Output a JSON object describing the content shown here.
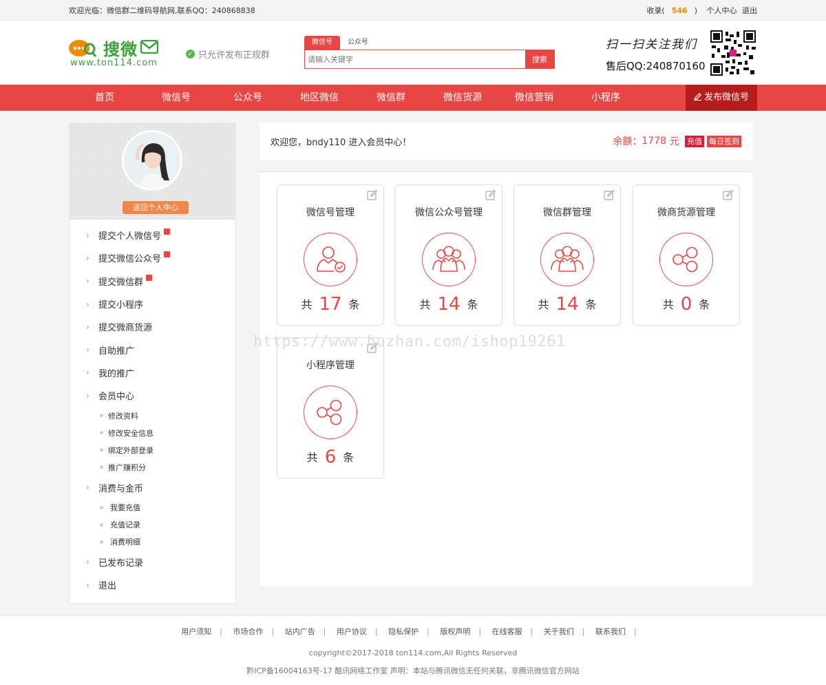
{
  "topbar": {
    "welcome": "欢迎光临：微信群二维码导航网,联系QQ：240868838",
    "fav_label": "收录(",
    "fav_count": "546",
    "fav_close": ")",
    "member_center": "个人中心",
    "logout": "退出"
  },
  "header": {
    "logo_text": "搜微",
    "logo_url": "www.ton114.com",
    "notice": "只允许发布正规群",
    "search": {
      "tabs": [
        "微信号",
        "公众号"
      ],
      "placeholder": "请输入关键字",
      "button": "搜索"
    },
    "slogan": "扫一扫关注我们",
    "aftersale": "售后QQ:240870160"
  },
  "nav": {
    "items": [
      "首页",
      "微信号",
      "公众号",
      "地区微信",
      "微信群",
      "微信货源",
      "微信营销",
      "小程序"
    ],
    "publish": "发布微信号"
  },
  "sidebar": {
    "back_button": "返回个人中心",
    "menu": [
      {
        "label": "提交个人微信号",
        "hot": true
      },
      {
        "label": "提交微信公众号",
        "hot": true
      },
      {
        "label": "提交微信群",
        "hot": true
      },
      {
        "label": "提交小程序",
        "hot": false
      },
      {
        "label": "提交微商货源",
        "hot": false
      },
      {
        "label": "自助推广",
        "hot": false
      },
      {
        "label": "我的推广",
        "hot": false
      },
      {
        "label": "会员中心",
        "hot": false
      },
      {
        "label": "消费与金币",
        "hot": false
      },
      {
        "label": "已发布记录",
        "hot": false
      },
      {
        "label": "退出",
        "hot": false
      }
    ],
    "member_sub": [
      "修改资料",
      "修改安全信息",
      "绑定外部登录",
      "推广赚积分"
    ],
    "finance_sub": [
      "我要充值",
      "充值记录",
      "消费明细"
    ]
  },
  "welcome": {
    "message": "欢迎您，bndy110 进入会员中心！",
    "balance_label": "余额：",
    "balance_value": "1778",
    "balance_unit": "元",
    "recharge": "充值",
    "checkin": "每日签到"
  },
  "cards": [
    {
      "title": "微信号管理",
      "prefix": "共",
      "count": "17",
      "suffix": "条",
      "icon": "user-check-icon"
    },
    {
      "title": "微信公众号管理",
      "prefix": "共",
      "count": "14",
      "suffix": "条",
      "icon": "users-group-icon"
    },
    {
      "title": "微信群管理",
      "prefix": "共",
      "count": "14",
      "suffix": "条",
      "icon": "users-group-icon"
    },
    {
      "title": "微商货源管理",
      "prefix": "共",
      "count": "0",
      "suffix": "条",
      "icon": "share-nodes-icon"
    },
    {
      "title": "小程序管理",
      "prefix": "共",
      "count": "6",
      "suffix": "条",
      "icon": "share-nodes-icon"
    }
  ],
  "watermark": "https://www.huzhan.com/ishop19261",
  "footer": {
    "links": [
      "用户须知",
      "市场合作",
      "站内广告",
      "用户协议",
      "隐私保护",
      "版权声明",
      "在线客服",
      "关于我们",
      "联系我们"
    ],
    "copyright": "copyright©2017-2018 ton114.com,All Rights Reserved",
    "icp": "黔ICP备16004163号-17 酷讯网络工作室   声明：本站与腾讯微信无任何关联，非腾讯微信官方网站"
  },
  "colors": {
    "brand_red": "#e84545",
    "dark_red": "#b71c1c",
    "orange": "#f0874a",
    "green": "#3aa13a"
  }
}
